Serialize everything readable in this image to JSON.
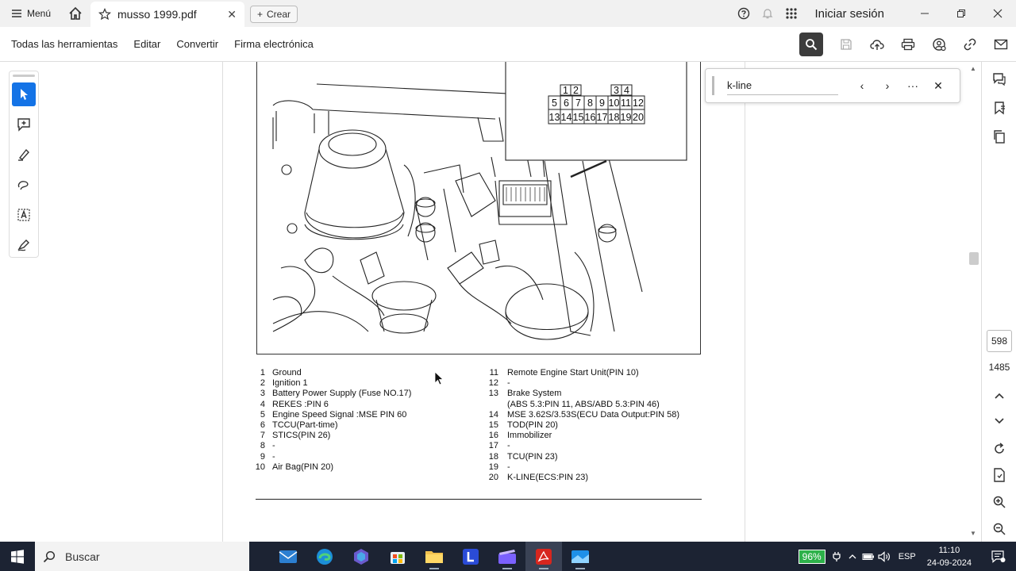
{
  "titlebar": {
    "menu_label": "Menú",
    "tab_title": "musso 1999.pdf",
    "create_label": "Crear",
    "signin_label": "Iniciar sesión"
  },
  "toolbar": {
    "items": [
      "Todas las herramientas",
      "Editar",
      "Convertir",
      "Firma electrónica"
    ]
  },
  "find": {
    "query": "k-line"
  },
  "document": {
    "legend_left": [
      {
        "num": "1",
        "text": "Ground"
      },
      {
        "num": "2",
        "text": "Ignition 1"
      },
      {
        "num": "3",
        "text": "Battery Power Supply (Fuse NO.17)"
      },
      {
        "num": "4",
        "text": "REKES :PIN 6"
      },
      {
        "num": "5",
        "text": "Engine Speed Signal :MSE PIN 60"
      },
      {
        "num": "6",
        "text": "TCCU(Part-time)"
      },
      {
        "num": "7",
        "text": "STICS(PIN 26)"
      },
      {
        "num": "8",
        "text": "-"
      },
      {
        "num": "9",
        "text": "-"
      },
      {
        "num": "10",
        "text": "Air Bag(PIN 20)"
      }
    ],
    "legend_right": [
      {
        "num": "11",
        "text": "Remote Engine Start Unit(PIN 10)"
      },
      {
        "num": "12",
        "text": "-"
      },
      {
        "num": "13",
        "text": "Brake System"
      },
      {
        "num": "",
        "text": "(ABS 5.3:PIN 11, ABS/ABD 5.3:PIN 46)"
      },
      {
        "num": "14",
        "text": "MSE 3.62S/3.53S(ECU Data Output:PIN 58)"
      },
      {
        "num": "15",
        "text": "TOD(PIN 20)"
      },
      {
        "num": "16",
        "text": "Immobilizer"
      },
      {
        "num": "17",
        "text": "-"
      },
      {
        "num": "18",
        "text": "TCU(PIN 23)"
      },
      {
        "num": "19",
        "text": "-"
      },
      {
        "num": "20",
        "text": "K-LINE(ECS:PIN 23)"
      }
    ],
    "connector_top_pins": [
      "1",
      "2",
      "3",
      "4"
    ],
    "connector_mid_pins": [
      "5",
      "6",
      "7",
      "8",
      "9",
      "10",
      "11",
      "12"
    ],
    "connector_bot_pins": [
      "13",
      "14",
      "15",
      "16",
      "17",
      "18",
      "19",
      "20"
    ]
  },
  "pagenav": {
    "current_page": "598",
    "total_pages": "1485"
  },
  "taskbar": {
    "search_label": "Buscar",
    "battery": "96%",
    "lang": "ESP",
    "time": "11:10",
    "date": "24-09-2024"
  },
  "colors": {
    "accent": "#1473e6",
    "taskbar": "#1c2333",
    "battery": "#2db14a"
  }
}
